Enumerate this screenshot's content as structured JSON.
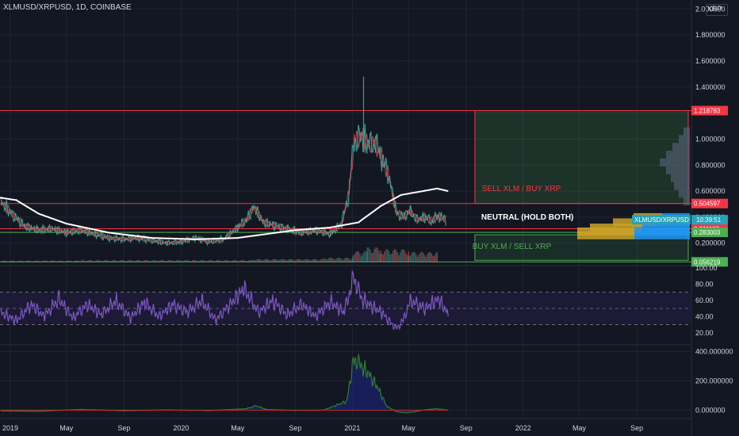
{
  "header": {
    "symbol": "XLMUSD/XRPUSD, 1D, COINBASE",
    "currency_badge": "XRP"
  },
  "colors": {
    "background": "#131722",
    "text": "#d1d4dc",
    "grid": "#1f2433",
    "red_line": "#f23645",
    "green_line": "#4caf50",
    "ma_line": "#ffffff",
    "rsi_line": "#7e57c2",
    "rsi_band": "#1c1a35",
    "candle_up": "#26a69a",
    "candle_down": "#ef5350",
    "profile_yellow": "#c9a227",
    "profile_blue": "#2196f3",
    "tag_cyan": "#26a3b8",
    "osc_up": "#2e7d32",
    "osc_down": "#c62828",
    "osc_fill": "#1a237e"
  },
  "chart_data": [
    {
      "type": "line",
      "name": "price",
      "x_range": [
        "2018-12-10",
        "2022-12-20"
      ],
      "x_tick_labels": [
        "2019",
        "May",
        "Sep",
        "2020",
        "May",
        "Sep",
        "2021",
        "May",
        "Sep",
        "2022",
        "May",
        "Sep"
      ],
      "x_tick_dates": [
        "2019-01-01",
        "2019-05-01",
        "2019-09-01",
        "2020-01-01",
        "2020-05-01",
        "2020-09-01",
        "2021-01-01",
        "2021-05-01",
        "2021-09-01",
        "2022-01-01",
        "2022-05-01",
        "2022-09-01"
      ],
      "y_range": [
        0.04,
        2.02
      ],
      "y_ticks": [
        "2.000000",
        "1.800000",
        "1.600000",
        "1.400000",
        "1.200000",
        "1.000000",
        "0.800000",
        "0.600000",
        "0.400000",
        "0.200000"
      ],
      "y_tick_values": [
        2.0,
        1.8,
        1.6,
        1.4,
        1.2,
        1.0,
        0.8,
        0.6,
        0.4,
        0.2
      ],
      "close_series": [
        [
          "2018-12-12",
          0.52
        ],
        [
          "2019-01-01",
          0.44
        ],
        [
          "2019-02-01",
          0.33
        ],
        [
          "2019-03-01",
          0.3
        ],
        [
          "2019-04-01",
          0.31
        ],
        [
          "2019-05-01",
          0.28
        ],
        [
          "2019-06-01",
          0.3
        ],
        [
          "2019-07-01",
          0.27
        ],
        [
          "2019-08-01",
          0.24
        ],
        [
          "2019-09-01",
          0.23
        ],
        [
          "2019-10-01",
          0.24
        ],
        [
          "2019-11-01",
          0.22
        ],
        [
          "2019-12-01",
          0.2
        ],
        [
          "2020-01-01",
          0.21
        ],
        [
          "2020-02-01",
          0.24
        ],
        [
          "2020-03-01",
          0.21
        ],
        [
          "2020-04-01",
          0.23
        ],
        [
          "2020-05-01",
          0.32
        ],
        [
          "2020-05-20",
          0.38
        ],
        [
          "2020-06-05",
          0.48
        ],
        [
          "2020-06-25",
          0.36
        ],
        [
          "2020-07-15",
          0.34
        ],
        [
          "2020-08-15",
          0.31
        ],
        [
          "2020-09-15",
          0.28
        ],
        [
          "2020-10-15",
          0.3
        ],
        [
          "2020-11-15",
          0.27
        ],
        [
          "2020-12-10",
          0.35
        ],
        [
          "2020-12-25",
          0.58
        ],
        [
          "2021-01-05",
          0.98
        ],
        [
          "2021-01-20",
          1.02
        ],
        [
          "2021-02-05",
          0.96
        ],
        [
          "2021-02-20",
          0.97
        ],
        [
          "2021-03-05",
          0.86
        ],
        [
          "2021-03-20",
          0.72
        ],
        [
          "2021-04-05",
          0.44
        ],
        [
          "2021-04-20",
          0.4
        ],
        [
          "2021-05-05",
          0.45
        ],
        [
          "2021-05-20",
          0.38
        ],
        [
          "2021-06-05",
          0.4
        ],
        [
          "2021-06-20",
          0.37
        ],
        [
          "2021-07-05",
          0.41
        ],
        [
          "2021-07-20",
          0.38
        ]
      ],
      "moving_average": [
        [
          "2018-12-10",
          0.55
        ],
        [
          "2019-01-15",
          0.53
        ],
        [
          "2019-03-01",
          0.43
        ],
        [
          "2019-05-01",
          0.35
        ],
        [
          "2019-08-01",
          0.28
        ],
        [
          "2019-11-01",
          0.24
        ],
        [
          "2020-02-01",
          0.23
        ],
        [
          "2020-05-01",
          0.24
        ],
        [
          "2020-07-01",
          0.27
        ],
        [
          "2020-09-01",
          0.3
        ],
        [
          "2020-11-15",
          0.32
        ],
        [
          "2021-01-15",
          0.36
        ],
        [
          "2021-03-01",
          0.48
        ],
        [
          "2021-04-15",
          0.57
        ],
        [
          "2021-06-01",
          0.6
        ],
        [
          "2021-07-01",
          0.62
        ],
        [
          "2021-07-25",
          0.6
        ]
      ],
      "spike_high": [
        "2021-01-25",
        1.48
      ],
      "volume_scale_max": 1,
      "volume_profile": [
        [
          "2018-12",
          0.1
        ],
        [
          "2019-06",
          0.12
        ],
        [
          "2019-12",
          0.12
        ],
        [
          "2020-06",
          0.18
        ],
        [
          "2020-11",
          0.25
        ],
        [
          "2021-01",
          0.6
        ],
        [
          "2021-02",
          0.8
        ],
        [
          "2021-03",
          0.7
        ],
        [
          "2021-05",
          0.55
        ],
        [
          "2021-07",
          0.4
        ]
      ],
      "levels": [
        {
          "value": 1.218783,
          "label": "1.218783",
          "color": "#f23645"
        },
        {
          "value": 0.504597,
          "label": "0.504597",
          "color": "#f23645"
        },
        {
          "value": 0.311193,
          "label": "0.311193",
          "color": "#f23645"
        },
        {
          "value": 0.283003,
          "label": "0.283003",
          "color": "#4caf50"
        },
        {
          "value": 0.056219,
          "label": "0.056219",
          "color": "#4caf50"
        }
      ],
      "annotations": [
        {
          "text": "SELL XLM / BUY XRP",
          "color": "#f23645"
        },
        {
          "text": "NEUTRAL (HOLD BOTH)",
          "color": "#ffffff"
        },
        {
          "text": "BUY XLM / SELL XRP",
          "color": "#4caf50"
        }
      ],
      "price_tag": {
        "symbol": "XLMUSD/XRPUSD",
        "time": "10:39:51"
      }
    },
    {
      "type": "line",
      "name": "rsi",
      "y_range": [
        10,
        100
      ],
      "y_ticks": [
        "100.00",
        "80.00",
        "60.00",
        "40.00",
        "20.00"
      ],
      "y_tick_values": [
        100,
        80,
        60,
        40,
        20
      ],
      "band": [
        30,
        70
      ],
      "midline": 50,
      "series": [
        [
          "2018-12-12",
          45
        ],
        [
          "2019-01-15",
          35
        ],
        [
          "2019-02-15",
          55
        ],
        [
          "2019-03-15",
          40
        ],
        [
          "2019-04-15",
          62
        ],
        [
          "2019-05-15",
          38
        ],
        [
          "2019-06-15",
          55
        ],
        [
          "2019-07-15",
          42
        ],
        [
          "2019-08-15",
          60
        ],
        [
          "2019-09-15",
          38
        ],
        [
          "2019-10-15",
          58
        ],
        [
          "2019-11-15",
          40
        ],
        [
          "2019-12-15",
          55
        ],
        [
          "2020-01-15",
          45
        ],
        [
          "2020-02-15",
          60
        ],
        [
          "2020-03-15",
          35
        ],
        [
          "2020-04-15",
          55
        ],
        [
          "2020-05-15",
          75
        ],
        [
          "2020-06-15",
          45
        ],
        [
          "2020-07-15",
          60
        ],
        [
          "2020-08-15",
          42
        ],
        [
          "2020-09-15",
          55
        ],
        [
          "2020-10-15",
          40
        ],
        [
          "2020-11-15",
          58
        ],
        [
          "2020-12-15",
          45
        ],
        [
          "2021-01-05",
          90
        ],
        [
          "2021-01-20",
          62
        ],
        [
          "2021-02-05",
          55
        ],
        [
          "2021-03-05",
          45
        ],
        [
          "2021-04-05",
          25
        ],
        [
          "2021-04-20",
          35
        ],
        [
          "2021-05-05",
          60
        ],
        [
          "2021-06-05",
          50
        ],
        [
          "2021-07-05",
          62
        ],
        [
          "2021-07-25",
          42
        ]
      ]
    },
    {
      "type": "area",
      "name": "oscillator",
      "y_range": [
        -25,
        420
      ],
      "y_ticks": [
        "400.000000",
        "200.000000",
        "0.000000"
      ],
      "y_tick_values": [
        400,
        200,
        0
      ],
      "series": [
        [
          "2018-12-12",
          -5
        ],
        [
          "2019-03-01",
          -8
        ],
        [
          "2019-06-01",
          5
        ],
        [
          "2019-09-01",
          -4
        ],
        [
          "2019-12-01",
          2
        ],
        [
          "2020-03-01",
          -3
        ],
        [
          "2020-05-20",
          10
        ],
        [
          "2020-06-10",
          30
        ],
        [
          "2020-07-01",
          5
        ],
        [
          "2020-09-01",
          -2
        ],
        [
          "2020-11-01",
          0
        ],
        [
          "2020-12-20",
          60
        ],
        [
          "2021-01-05",
          360
        ],
        [
          "2021-01-20",
          300
        ],
        [
          "2021-02-05",
          250
        ],
        [
          "2021-02-25",
          150
        ],
        [
          "2021-03-15",
          30
        ],
        [
          "2021-04-05",
          -10
        ],
        [
          "2021-04-25",
          -18
        ],
        [
          "2021-05-15",
          -10
        ],
        [
          "2021-06-05",
          2
        ],
        [
          "2021-07-01",
          10
        ],
        [
          "2021-07-25",
          0
        ]
      ]
    }
  ]
}
